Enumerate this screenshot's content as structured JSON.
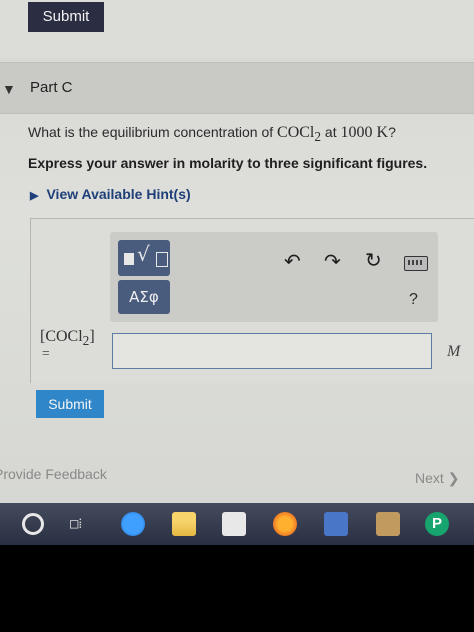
{
  "top": {
    "submit_label": "Submit"
  },
  "part": {
    "title": "Part C"
  },
  "question": {
    "prefix": "What is the equilibrium concentration of ",
    "species": "COCl",
    "species_subscript": "2",
    "middle": " at ",
    "temperature": "1000 K",
    "suffix": "?"
  },
  "instruction": "Express your answer in molarity to three significant figures.",
  "hint": {
    "label": "View Available Hint(s)"
  },
  "toolbar": {
    "greek_label": "ΑΣφ",
    "help_label": "?"
  },
  "answer": {
    "variable_label": "[COCl",
    "variable_subscript": "2",
    "variable_close": "]",
    "equals": "=",
    "value": "",
    "unit": "M"
  },
  "submit_label": "Submit",
  "footer": {
    "feedback_label": "Provide Feedback",
    "next_label": "Next"
  },
  "colors": {
    "accent": "#2f86c8",
    "dark_button": "#2b2d42",
    "template_button": "#4a5c7e",
    "hint_text": "#1e3f78"
  },
  "taskbar_icons": [
    "start-icon",
    "task-view-icon",
    "edge-icon",
    "file-explorer-icon",
    "store-icon",
    "firefox-icon",
    "mail-icon",
    "app-icon",
    "pearson-icon"
  ]
}
